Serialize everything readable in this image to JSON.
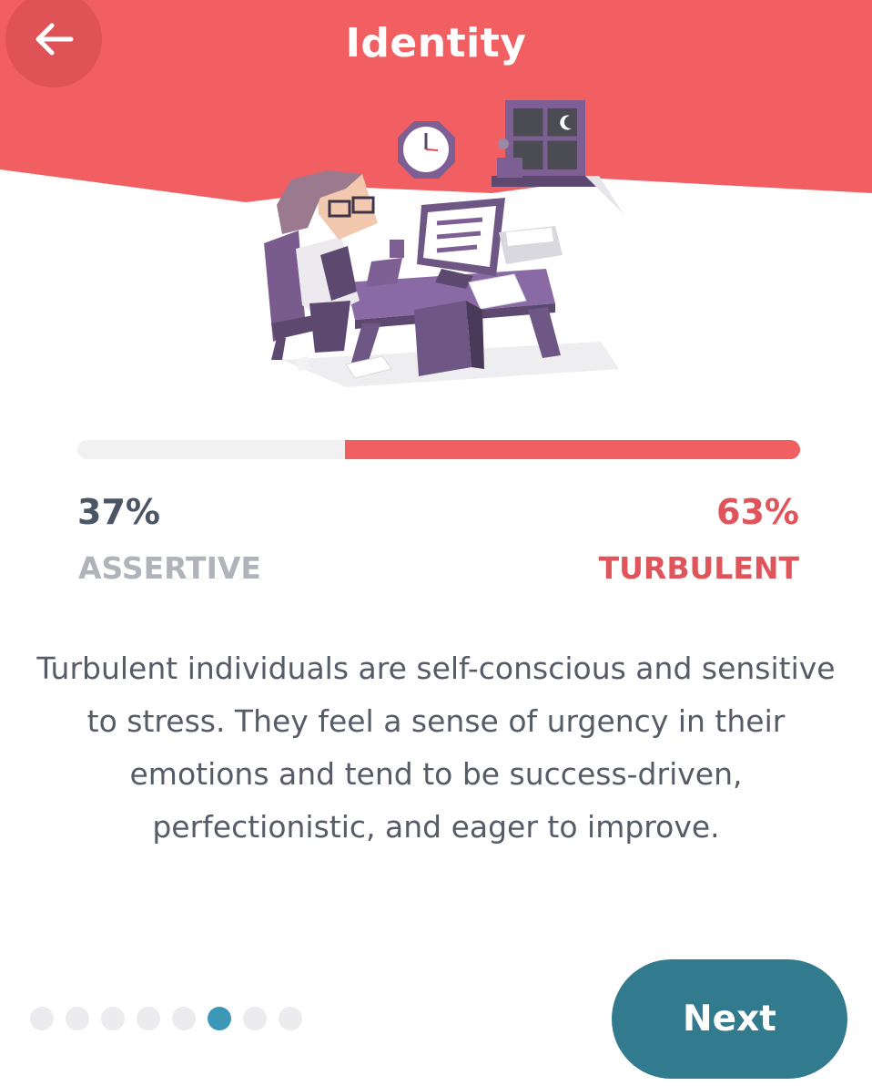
{
  "header": {
    "title": "Identity",
    "back_icon": "arrow-left-icon",
    "color": "#f15f62"
  },
  "illustration": {
    "subject": "stressed-worker-at-desk-illustration"
  },
  "trait": {
    "assertive": {
      "percent": "37%",
      "label": "ASSERTIVE",
      "value": 37
    },
    "turbulent": {
      "percent": "63%",
      "label": "TURBULENT",
      "value": 63,
      "color": "#e0555b"
    }
  },
  "description": "Turbulent individuals are self-conscious and sensitive to stress. They feel a sense of urgency in their emotions and tend to be success-driven, perfectionistic, and eager to improve.",
  "pager": {
    "count": 8,
    "active_index": 5,
    "active_color": "#3d97b7"
  },
  "next_button": {
    "label": "Next",
    "color": "#327b8e"
  }
}
